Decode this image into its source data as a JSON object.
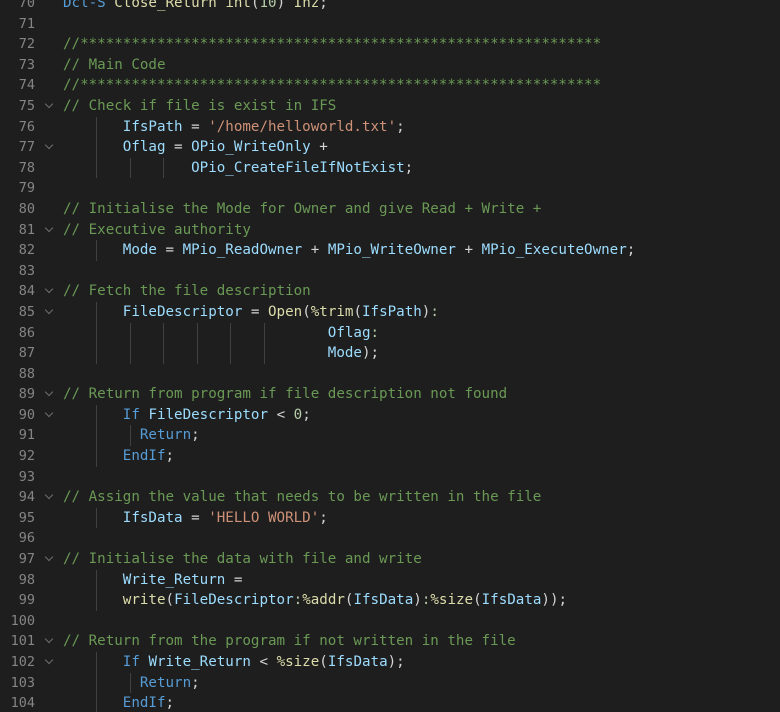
{
  "editor": {
    "lines": [
      {
        "num": "70",
        "fold": false,
        "guides": [],
        "tokens": [
          [
            "k",
            "Dcl-S"
          ],
          [
            "p",
            " "
          ],
          [
            "f",
            "Close_Return"
          ],
          [
            "p",
            " "
          ],
          [
            "f",
            "int"
          ],
          [
            "p",
            "("
          ],
          [
            "n",
            "10"
          ],
          [
            "p",
            ") "
          ],
          [
            "f",
            "Inz"
          ],
          [
            "p",
            ";"
          ]
        ]
      },
      {
        "num": "71",
        "fold": false,
        "guides": [],
        "tokens": []
      },
      {
        "num": "72",
        "fold": false,
        "guides": [],
        "tokens": [
          [
            "c",
            "//*************************************************************"
          ]
        ]
      },
      {
        "num": "73",
        "fold": false,
        "guides": [],
        "tokens": [
          [
            "c",
            "// Main Code"
          ]
        ]
      },
      {
        "num": "74",
        "fold": false,
        "guides": [],
        "tokens": [
          [
            "c",
            "//*************************************************************"
          ]
        ]
      },
      {
        "num": "75",
        "fold": true,
        "guides": [],
        "tokens": [
          [
            "c",
            "// Check if file is exist in IFS"
          ]
        ]
      },
      {
        "num": "76",
        "fold": false,
        "guides": [
          0
        ],
        "tokens": [
          [
            "p",
            "       "
          ],
          [
            "v",
            "IfsPath"
          ],
          [
            "p",
            " = "
          ],
          [
            "s",
            "'/home/helloworld.txt'"
          ],
          [
            "p",
            ";"
          ]
        ]
      },
      {
        "num": "77",
        "fold": true,
        "guides": [
          0
        ],
        "tokens": [
          [
            "p",
            "       "
          ],
          [
            "v",
            "Oflag"
          ],
          [
            "p",
            " = "
          ],
          [
            "v",
            "OPio_WriteOnly"
          ],
          [
            "p",
            " +"
          ]
        ]
      },
      {
        "num": "78",
        "fold": false,
        "guides": [
          0,
          1,
          2
        ],
        "tokens": [
          [
            "p",
            "               "
          ],
          [
            "v",
            "OPio_CreateFileIfNotExist"
          ],
          [
            "p",
            ";"
          ]
        ]
      },
      {
        "num": "79",
        "fold": false,
        "guides": [],
        "tokens": []
      },
      {
        "num": "80",
        "fold": false,
        "guides": [],
        "tokens": [
          [
            "c",
            "// Initialise the Mode for Owner and give Read + Write +"
          ]
        ]
      },
      {
        "num": "81",
        "fold": true,
        "guides": [],
        "tokens": [
          [
            "c",
            "// Executive authority"
          ]
        ]
      },
      {
        "num": "82",
        "fold": false,
        "guides": [
          0
        ],
        "tokens": [
          [
            "p",
            "       "
          ],
          [
            "v",
            "Mode"
          ],
          [
            "p",
            " = "
          ],
          [
            "v",
            "MPio_ReadOwner"
          ],
          [
            "p",
            " + "
          ],
          [
            "v",
            "MPio_WriteOwner"
          ],
          [
            "p",
            " + "
          ],
          [
            "v",
            "MPio_ExecuteOwner"
          ],
          [
            "p",
            ";"
          ]
        ]
      },
      {
        "num": "83",
        "fold": false,
        "guides": [],
        "tokens": []
      },
      {
        "num": "84",
        "fold": true,
        "guides": [],
        "tokens": [
          [
            "c",
            "// Fetch the file description"
          ]
        ]
      },
      {
        "num": "85",
        "fold": true,
        "guides": [
          0
        ],
        "tokens": [
          [
            "p",
            "       "
          ],
          [
            "v",
            "FileDescriptor"
          ],
          [
            "p",
            " = "
          ],
          [
            "f",
            "Open"
          ],
          [
            "p",
            "("
          ],
          [
            "f",
            "%trim"
          ],
          [
            "p",
            "("
          ],
          [
            "v",
            "IfsPath"
          ],
          [
            "p",
            ")"
          ],
          [
            "n",
            ":"
          ]
        ]
      },
      {
        "num": "86",
        "fold": false,
        "guides": [
          0,
          1,
          2,
          3,
          4,
          5
        ],
        "tokens": [
          [
            "p",
            "                               "
          ],
          [
            "v",
            "Oflag"
          ],
          [
            "n",
            ":"
          ]
        ]
      },
      {
        "num": "87",
        "fold": false,
        "guides": [
          0,
          1,
          2,
          3,
          4,
          5
        ],
        "tokens": [
          [
            "p",
            "                               "
          ],
          [
            "v",
            "Mode"
          ],
          [
            "p",
            ");"
          ]
        ]
      },
      {
        "num": "88",
        "fold": false,
        "guides": [],
        "tokens": []
      },
      {
        "num": "89",
        "fold": true,
        "guides": [],
        "tokens": [
          [
            "c",
            "// Return from program if file description not found"
          ]
        ]
      },
      {
        "num": "90",
        "fold": true,
        "guides": [
          0
        ],
        "tokens": [
          [
            "p",
            "       "
          ],
          [
            "k",
            "If"
          ],
          [
            "p",
            " "
          ],
          [
            "v",
            "FileDescriptor"
          ],
          [
            "p",
            " < "
          ],
          [
            "n",
            "0"
          ],
          [
            "p",
            ";"
          ]
        ]
      },
      {
        "num": "91",
        "fold": false,
        "guides": [
          0,
          1
        ],
        "tokens": [
          [
            "p",
            "         "
          ],
          [
            "k",
            "Return"
          ],
          [
            "p",
            ";"
          ]
        ]
      },
      {
        "num": "92",
        "fold": false,
        "guides": [
          0
        ],
        "tokens": [
          [
            "p",
            "       "
          ],
          [
            "k",
            "EndIf"
          ],
          [
            "p",
            ";"
          ]
        ]
      },
      {
        "num": "93",
        "fold": false,
        "guides": [],
        "tokens": []
      },
      {
        "num": "94",
        "fold": true,
        "guides": [],
        "tokens": [
          [
            "c",
            "// Assign the value that needs to be written in the file"
          ]
        ]
      },
      {
        "num": "95",
        "fold": false,
        "guides": [
          0
        ],
        "tokens": [
          [
            "p",
            "       "
          ],
          [
            "v",
            "IfsData"
          ],
          [
            "p",
            " = "
          ],
          [
            "s",
            "'HELLO WORLD'"
          ],
          [
            "p",
            ";"
          ]
        ]
      },
      {
        "num": "96",
        "fold": false,
        "guides": [],
        "tokens": []
      },
      {
        "num": "97",
        "fold": true,
        "guides": [],
        "tokens": [
          [
            "c",
            "// Initialise the data with file and write"
          ]
        ]
      },
      {
        "num": "98",
        "fold": false,
        "guides": [
          0
        ],
        "tokens": [
          [
            "p",
            "       "
          ],
          [
            "v",
            "Write_Return"
          ],
          [
            "p",
            " ="
          ]
        ]
      },
      {
        "num": "99",
        "fold": false,
        "guides": [
          0
        ],
        "tokens": [
          [
            "p",
            "       "
          ],
          [
            "f",
            "write"
          ],
          [
            "p",
            "("
          ],
          [
            "v",
            "FileDescriptor"
          ],
          [
            "n",
            ":"
          ],
          [
            "f",
            "%addr"
          ],
          [
            "p",
            "("
          ],
          [
            "v",
            "IfsData"
          ],
          [
            "p",
            ")"
          ],
          [
            "n",
            ":"
          ],
          [
            "f",
            "%size"
          ],
          [
            "p",
            "("
          ],
          [
            "v",
            "IfsData"
          ],
          [
            "p",
            "));"
          ]
        ]
      },
      {
        "num": "100",
        "fold": false,
        "guides": [],
        "tokens": []
      },
      {
        "num": "101",
        "fold": true,
        "guides": [],
        "tokens": [
          [
            "c",
            "// Return from the program if not written in the file"
          ]
        ]
      },
      {
        "num": "102",
        "fold": true,
        "guides": [
          0
        ],
        "tokens": [
          [
            "p",
            "       "
          ],
          [
            "k",
            "If"
          ],
          [
            "p",
            " "
          ],
          [
            "v",
            "Write_Return"
          ],
          [
            "p",
            " < "
          ],
          [
            "f",
            "%size"
          ],
          [
            "p",
            "("
          ],
          [
            "v",
            "IfsData"
          ],
          [
            "p",
            ");"
          ]
        ]
      },
      {
        "num": "103",
        "fold": false,
        "guides": [
          0,
          1
        ],
        "tokens": [
          [
            "p",
            "         "
          ],
          [
            "k",
            "Return"
          ],
          [
            "p",
            ";"
          ]
        ]
      },
      {
        "num": "104",
        "fold": false,
        "guides": [
          0
        ],
        "tokens": [
          [
            "p",
            "       "
          ],
          [
            "k",
            "EndIf"
          ],
          [
            "p",
            ";"
          ]
        ]
      }
    ]
  }
}
